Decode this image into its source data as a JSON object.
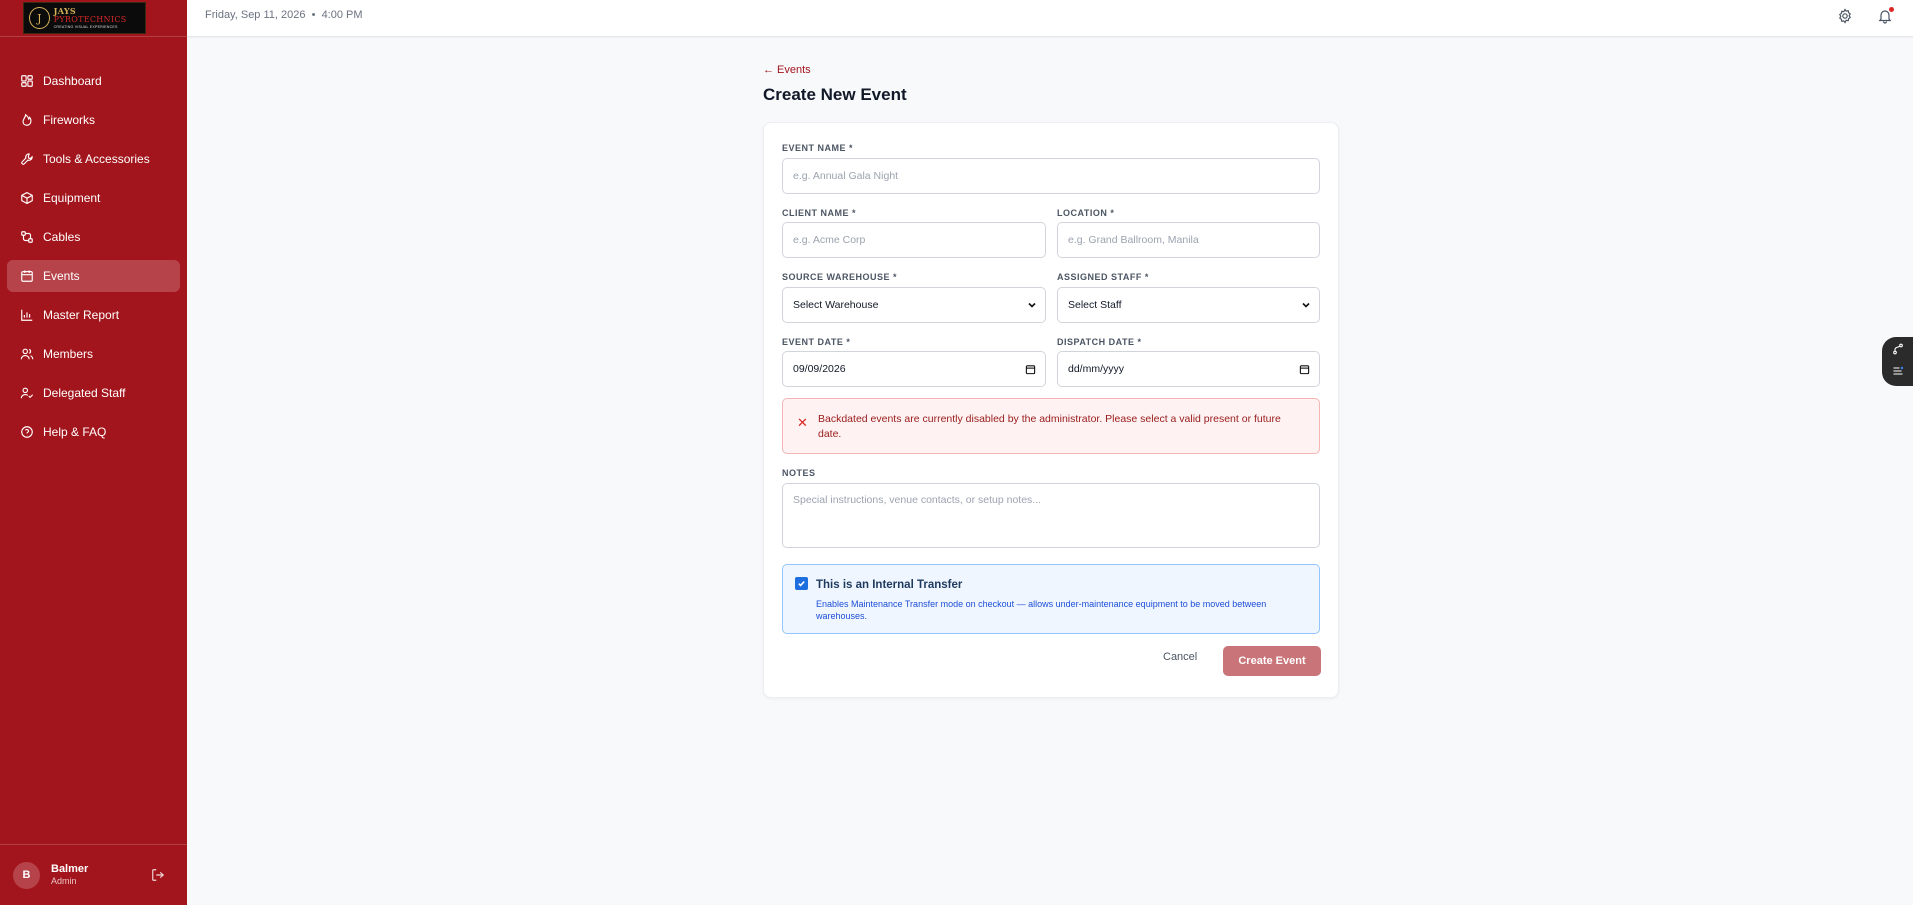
{
  "brand": {
    "logo_name": "JAYS",
    "logo_accent": "PYROTECHNICS",
    "logo_tagline": "CREATING VISUAL EXPERIENCES"
  },
  "sidebar": {
    "items": [
      {
        "label": "Dashboard",
        "icon": "dashboard-icon"
      },
      {
        "label": "Fireworks",
        "icon": "flame-icon"
      },
      {
        "label": "Tools & Accessories",
        "icon": "wrench-icon"
      },
      {
        "label": "Equipment",
        "icon": "box-icon"
      },
      {
        "label": "Cables",
        "icon": "cable-icon"
      },
      {
        "label": "Events",
        "icon": "calendar-icon",
        "active": true
      },
      {
        "label": "Master Report",
        "icon": "bar-chart-icon"
      },
      {
        "label": "Members",
        "icon": "users-icon"
      },
      {
        "label": "Delegated Staff",
        "icon": "user-check-icon"
      },
      {
        "label": "Help & FAQ",
        "icon": "help-circle-icon"
      }
    ],
    "user": {
      "initial": "B",
      "name": "Balmer",
      "role": "Admin"
    }
  },
  "header": {
    "datetime": "Friday, Sep 11, 2026  •  4:00 PM"
  },
  "page": {
    "back_label": "← Events",
    "title": "Create New Event"
  },
  "form": {
    "event_name": {
      "label": "EVENT NAME *",
      "placeholder": "e.g. Annual Gala Night"
    },
    "client_name": {
      "label": "CLIENT NAME *",
      "placeholder": "e.g. Acme Corp"
    },
    "location": {
      "label": "LOCATION *",
      "placeholder": "e.g. Grand Ballroom, Manila"
    },
    "source_warehouse": {
      "label": "SOURCE WAREHOUSE *",
      "value": "Select Warehouse"
    },
    "assigned_staff": {
      "label": "ASSIGNED STAFF *",
      "value": "Select Staff"
    },
    "event_date": {
      "label": "EVENT DATE *",
      "value": "09/09/2026"
    },
    "dispatch_date": {
      "label": "DISPATCH DATE *",
      "value": "dd/mm/yyyy"
    },
    "error": "Backdated events are currently disabled by the administrator. Please select a valid present or future date.",
    "notes": {
      "label": "NOTES",
      "placeholder": "Special instructions, venue contacts, or setup notes..."
    },
    "internal_transfer": {
      "checked": true,
      "title": "This is an Internal Transfer",
      "description": "Enables Maintenance Transfer mode on checkout — allows under-maintenance equipment to be moved between warehouses."
    },
    "cancel_label": "Cancel",
    "submit_label": "Create Event"
  },
  "colors": {
    "sidebar_bg": "#a3151c",
    "accent": "#a3151c",
    "submit_bg": "#c97479",
    "error_bg": "#fef2f2",
    "info_bg": "#eff6ff"
  }
}
